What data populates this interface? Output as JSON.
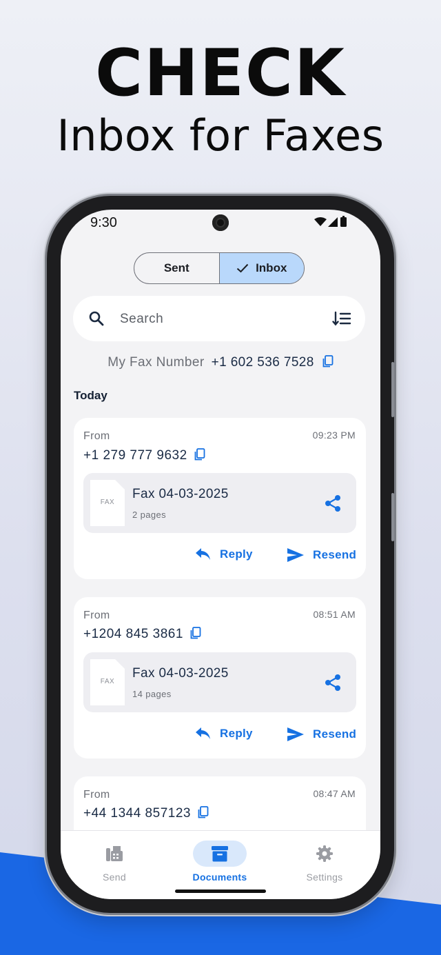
{
  "promo": {
    "headline": "CHECK",
    "subheadline": "Inbox for Faxes"
  },
  "status_bar": {
    "time": "9:30"
  },
  "tabs": [
    {
      "label": "Sent",
      "active": false
    },
    {
      "label": "Inbox",
      "active": true
    }
  ],
  "search": {
    "placeholder": "Search"
  },
  "my_fax": {
    "label": "My Fax Number",
    "number": "+1 602 536 7528"
  },
  "section_title": "Today",
  "faxes": [
    {
      "from_label": "From",
      "number": "+1 279 777 9632",
      "time": "09:23 PM",
      "doc": {
        "thumb": "FAX",
        "title": "Fax 04-03-2025",
        "pages": "2 pages"
      },
      "reply": "Reply",
      "resend": "Resend"
    },
    {
      "from_label": "From",
      "number": "+1204 845 3861",
      "time": "08:51 AM",
      "doc": {
        "thumb": "FAX",
        "title": "Fax 04-03-2025",
        "pages": "14 pages"
      },
      "reply": "Reply",
      "resend": "Resend"
    },
    {
      "from_label": "From",
      "number": "+44 1344 857123",
      "time": "08:47 AM"
    }
  ],
  "bottom_nav": [
    {
      "label": "Send",
      "icon": "fax-machine-icon",
      "active": false
    },
    {
      "label": "Documents",
      "icon": "archive-box-icon",
      "active": true
    },
    {
      "label": "Settings",
      "icon": "gear-icon",
      "active": false
    }
  ],
  "colors": {
    "accent": "#1671e2",
    "tab_active_bg": "#b9d8fb",
    "promo_blue": "#1a67e4",
    "text_dark": "#1a2b45"
  }
}
